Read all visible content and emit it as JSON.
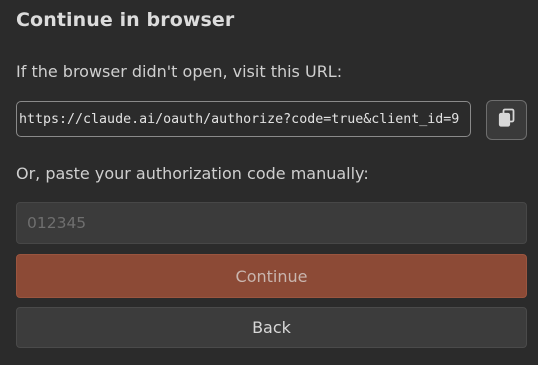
{
  "dialog": {
    "title": "Continue in browser",
    "url_prompt": "If the browser didn't open, visit this URL:",
    "url": "https://claude.ai/oauth/authorize?code=true&client_id=9",
    "copy_icon": "copy-icon",
    "code_prompt": "Or, paste your authorization code manually:",
    "code_value": "",
    "code_placeholder": "012345",
    "continue_label": "Continue",
    "back_label": "Back"
  },
  "colors": {
    "background": "#2b2b2b",
    "accent": "#8c4a36",
    "input_bg": "#3b3b3b",
    "secondary_button": "#3c3c3c"
  }
}
